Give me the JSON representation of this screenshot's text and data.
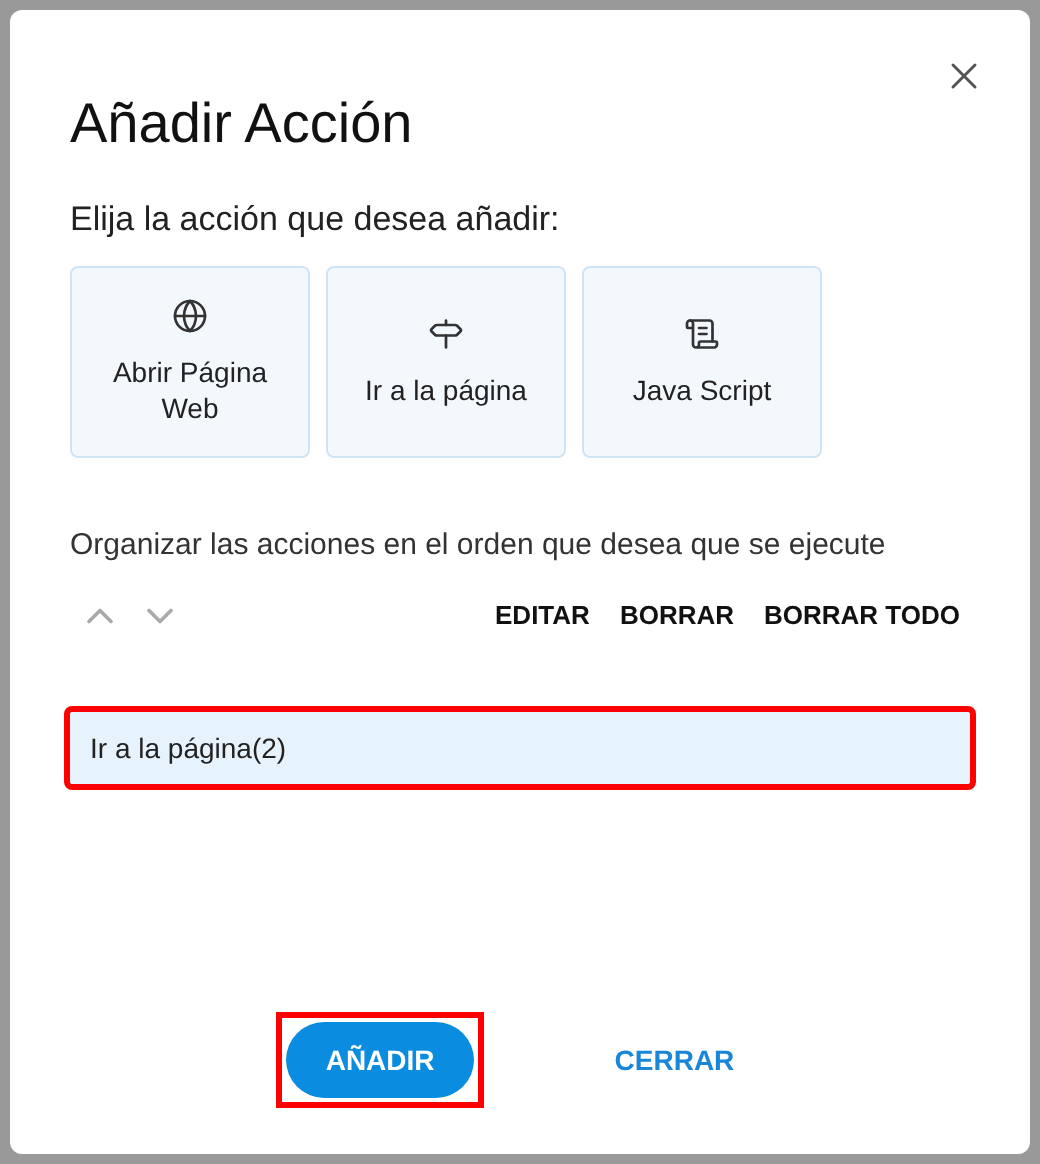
{
  "dialog": {
    "title": "Añadir Acción",
    "prompt": "Elija la acción que desea añadir:",
    "action_types": [
      {
        "kind": "globe",
        "label": "Abrir Página Web"
      },
      {
        "kind": "signpost",
        "label": "Ir a la página"
      },
      {
        "kind": "scroll",
        "label": "Java Script"
      }
    ],
    "order_hint": "Organizar las acciones en el orden que desea que se ejecute",
    "move_buttons": [
      {
        "kind": "up",
        "disabled": true
      },
      {
        "kind": "down",
        "disabled": true
      }
    ],
    "list_buttons": [
      "EDITAR",
      "BORRAR",
      "BORRAR TODO"
    ],
    "actions": [
      {
        "label": "Ir a la página(2)",
        "highlighted": true
      }
    ],
    "footer_buttons": [
      {
        "kind": "primary",
        "label": "AÑADIR",
        "highlighted": true
      },
      {
        "kind": "text",
        "label": "CERRAR",
        "highlighted": false
      }
    ]
  }
}
